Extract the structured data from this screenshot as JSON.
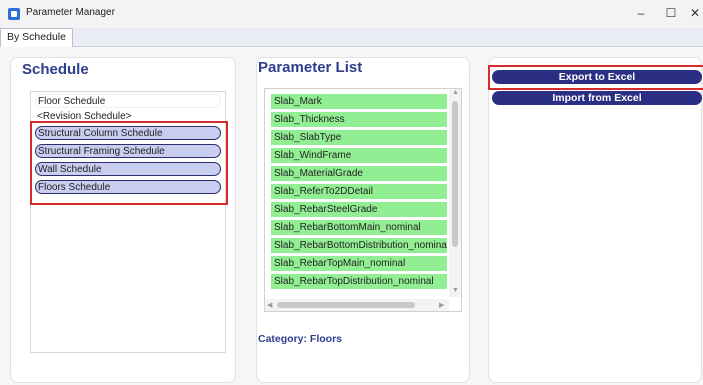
{
  "window": {
    "title": "Parameter Manager",
    "minimize": "–",
    "maximize": "☐",
    "close": "✕"
  },
  "tabs": [
    {
      "label": "By Schedule"
    }
  ],
  "schedule": {
    "heading": "Schedule",
    "items": [
      {
        "label": "Floor Schedule",
        "selected": false
      },
      {
        "label": "<Revision Schedule>",
        "selected": false
      },
      {
        "label": "Structural Column Schedule",
        "selected": true
      },
      {
        "label": "Structural Framing Schedule",
        "selected": true
      },
      {
        "label": "Wall Schedule",
        "selected": true
      },
      {
        "label": "Floors Schedule",
        "selected": true
      }
    ]
  },
  "parameters": {
    "heading": "Parameter List",
    "items": [
      "Slab_Mark",
      "Slab_Thickness",
      "Slab_SlabType",
      "Slab_WindFrame",
      "Slab_MaterialGrade",
      "Slab_ReferTo2DDetail",
      "Slab_RebarSteelGrade",
      "Slab_RebarBottomMain_nominal",
      "Slab_RebarBottomDistribution_nominal",
      "Slab_RebarTopMain_nominal",
      "Slab_RebarTopDistribution_nominal"
    ],
    "category": "Category: Floors"
  },
  "actions": {
    "export_label": "Export to Excel",
    "import_label": "Import from Excel"
  },
  "colors": {
    "accent": "#2b2f84",
    "heading": "#2e3e8e",
    "param_highlight": "#92ee92",
    "selected_item": "#c9cdf0",
    "annotation_red": "#d82c2c"
  }
}
